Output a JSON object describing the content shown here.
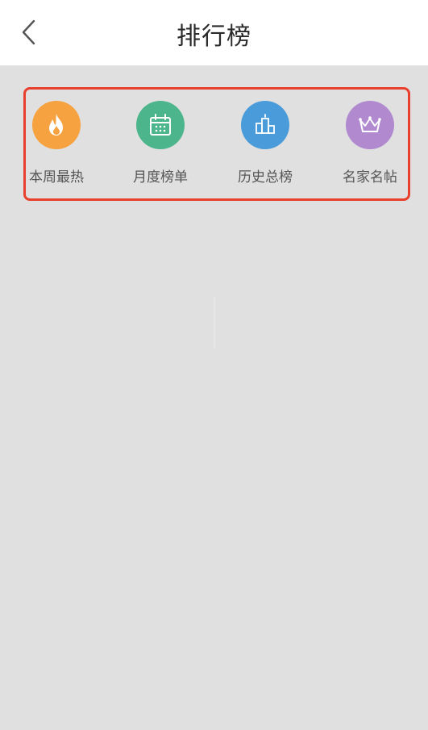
{
  "header": {
    "title": "排行榜",
    "back_icon": "chevron-left-icon"
  },
  "categories": [
    {
      "label": "本周最热",
      "icon": "flame-icon",
      "color": "#f7a240"
    },
    {
      "label": "月度榜单",
      "icon": "calendar-icon",
      "color": "#4cb58c"
    },
    {
      "label": "历史总榜",
      "icon": "podium-icon",
      "color": "#4a9bd9"
    },
    {
      "label": "名家名帖",
      "icon": "crown-icon",
      "color": "#b089cf"
    }
  ],
  "colors": {
    "background": "#e0e0e0",
    "header_bg": "#ffffff",
    "highlight_border": "#e8402c"
  }
}
